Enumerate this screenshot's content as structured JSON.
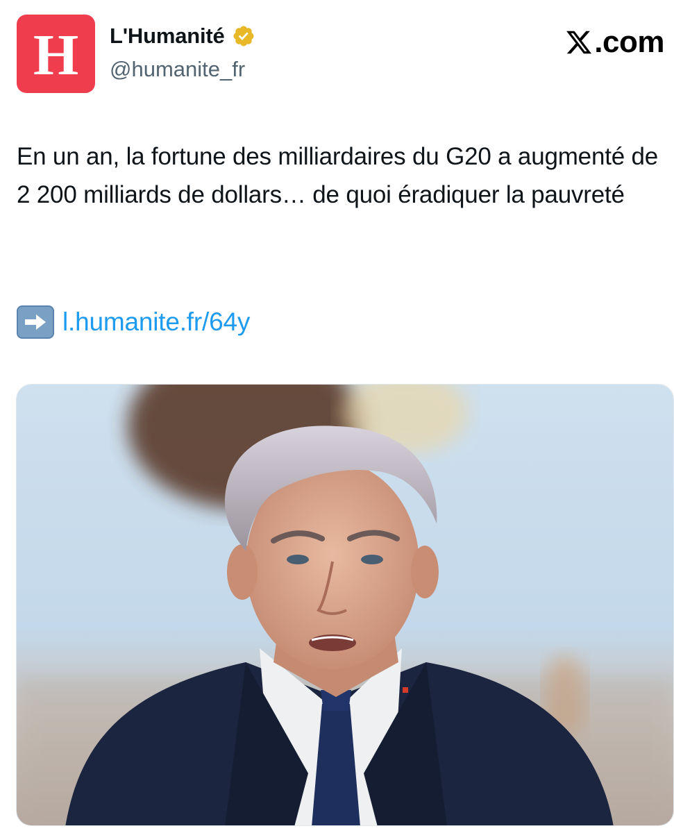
{
  "account": {
    "avatar_letter": "H",
    "display_name": "L'Humanité",
    "handle": "@humanite_fr",
    "verified_icon": "verified-badge-icon",
    "avatar_color": "#ef3d4e"
  },
  "brand": {
    "logo_icon": "x-logo-icon",
    "label": ".com"
  },
  "tweet": {
    "text": "En un an, la fortune des milliardaires du G20 a augmenté de 2 200 milliards de dollars… de quoi éradiquer la pauvreté",
    "link_icon": "right-arrow-emoji-icon",
    "link_text": "l.humanite.fr/64y",
    "link_color": "#1d9bf0"
  },
  "media": {
    "kind": "photo-of-man-speaking"
  }
}
